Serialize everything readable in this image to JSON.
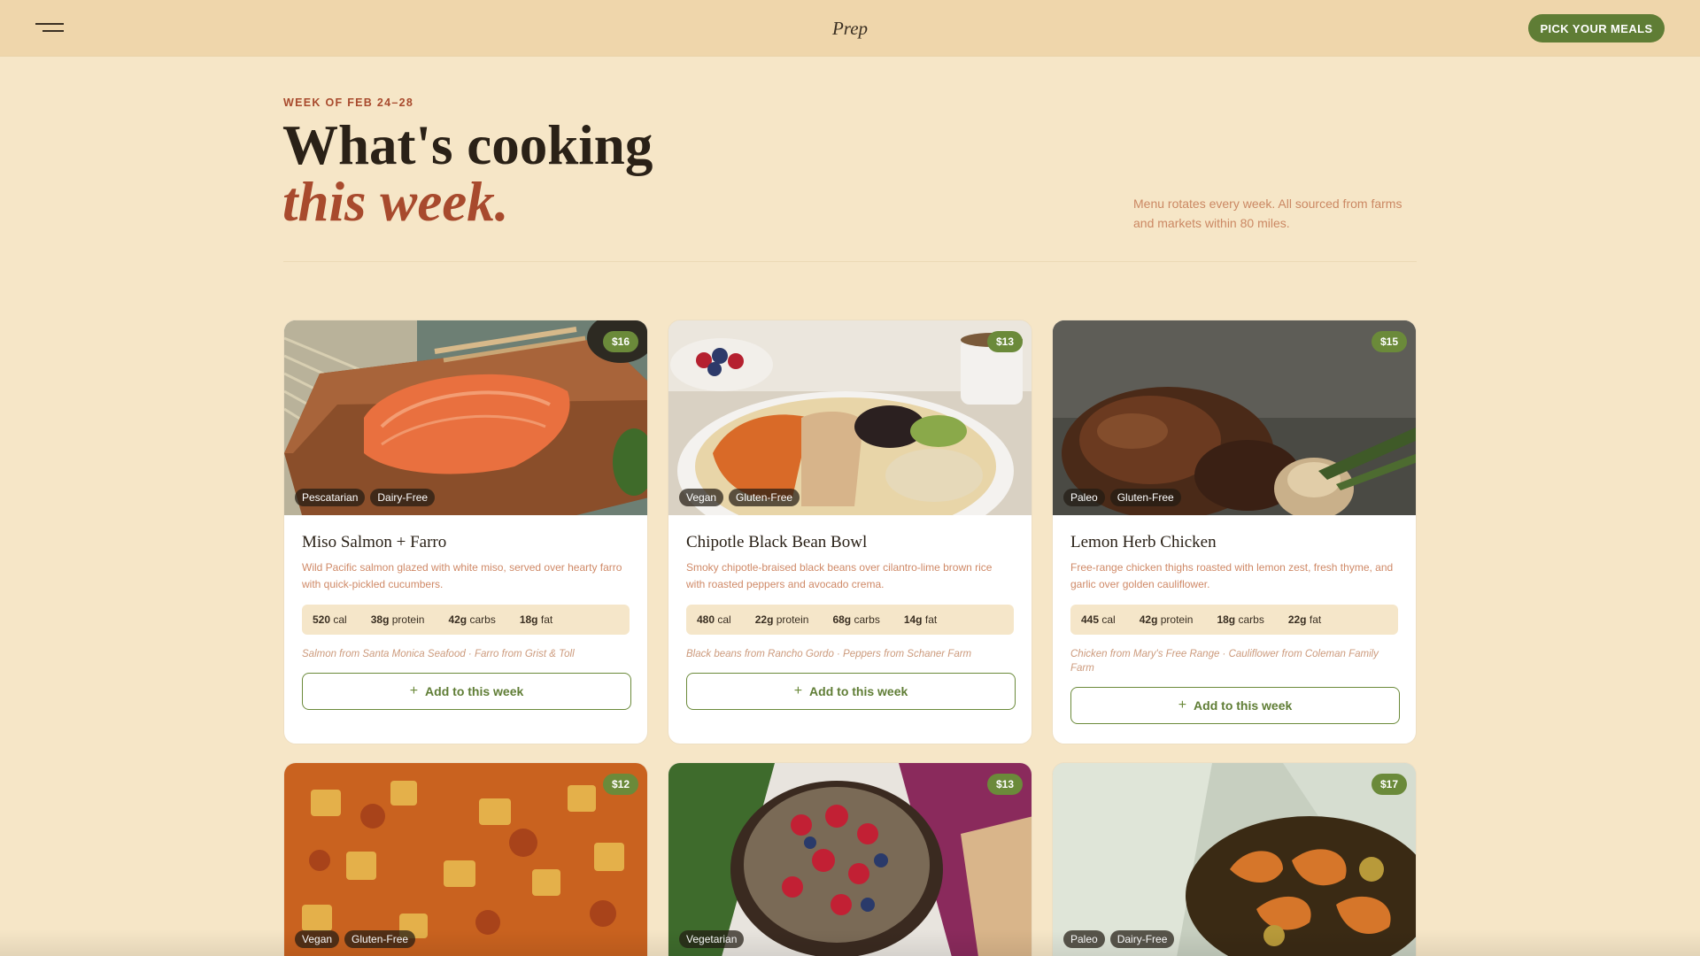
{
  "header": {
    "brand": "Prep",
    "cta_label": "PICK YOUR MEALS"
  },
  "hero": {
    "eyebrow": "WEEK OF FEB 24–28",
    "title_line1": "What's cooking",
    "title_line2": "this week.",
    "intro": "Menu rotates every week. All sourced from farms and markets within 80 miles."
  },
  "colors": {
    "accent_green": "#5f7d35",
    "accent_rust": "#a84a2d",
    "background": "#f6e6c7",
    "header_bg": "#efd6ab"
  },
  "meals": [
    {
      "name": "Miso Salmon + Farro",
      "price": "$16",
      "tags": [
        "Pescatarian",
        "Dairy-Free"
      ],
      "description": "Wild Pacific salmon glazed with white miso, served over hearty farro with quick-pickled cucumbers.",
      "macros": [
        {
          "value": "520",
          "unit": "cal"
        },
        {
          "value": "38g",
          "unit": "protein"
        },
        {
          "value": "42g",
          "unit": "carbs"
        },
        {
          "value": "18g",
          "unit": "fat"
        }
      ],
      "source": "Salmon from Santa Monica Seafood · Farro from Grist & Toll",
      "button_label": "Add to this week",
      "image": "salmon-fillet-photo"
    },
    {
      "name": "Chipotle Black Bean Bowl",
      "price": "$13",
      "tags": [
        "Vegan",
        "Gluten-Free"
      ],
      "description": "Smoky chipotle-braised black beans over cilantro-lime brown rice with roasted peppers and avocado crema.",
      "macros": [
        {
          "value": "480",
          "unit": "cal"
        },
        {
          "value": "22g",
          "unit": "protein"
        },
        {
          "value": "68g",
          "unit": "carbs"
        },
        {
          "value": "14g",
          "unit": "fat"
        }
      ],
      "source": "Black beans from Rancho Gordo · Peppers from Schaner Farm",
      "button_label": "Add to this week",
      "image": "grain-bowl-photo"
    },
    {
      "name": "Lemon Herb Chicken",
      "price": "$15",
      "tags": [
        "Paleo",
        "Gluten-Free"
      ],
      "description": "Free-range chicken thighs roasted with lemon zest, fresh thyme, and garlic over golden cauliflower.",
      "macros": [
        {
          "value": "445",
          "unit": "cal"
        },
        {
          "value": "42g",
          "unit": "protein"
        },
        {
          "value": "18g",
          "unit": "carbs"
        },
        {
          "value": "22g",
          "unit": "fat"
        }
      ],
      "source": "Chicken from Mary's Free Range · Cauliflower from Coleman Family Farm",
      "button_label": "Add to this week",
      "image": "roast-chicken-photo"
    },
    {
      "price": "$12",
      "tags": [
        "Vegan",
        "Gluten-Free"
      ],
      "image": "lentil-stew-photo"
    },
    {
      "price": "$13",
      "tags": [
        "Vegetarian"
      ],
      "image": "acai-bowl-photo"
    },
    {
      "price": "$17",
      "tags": [
        "Paleo",
        "Dairy-Free"
      ],
      "image": "grilled-shrimp-photo"
    }
  ]
}
